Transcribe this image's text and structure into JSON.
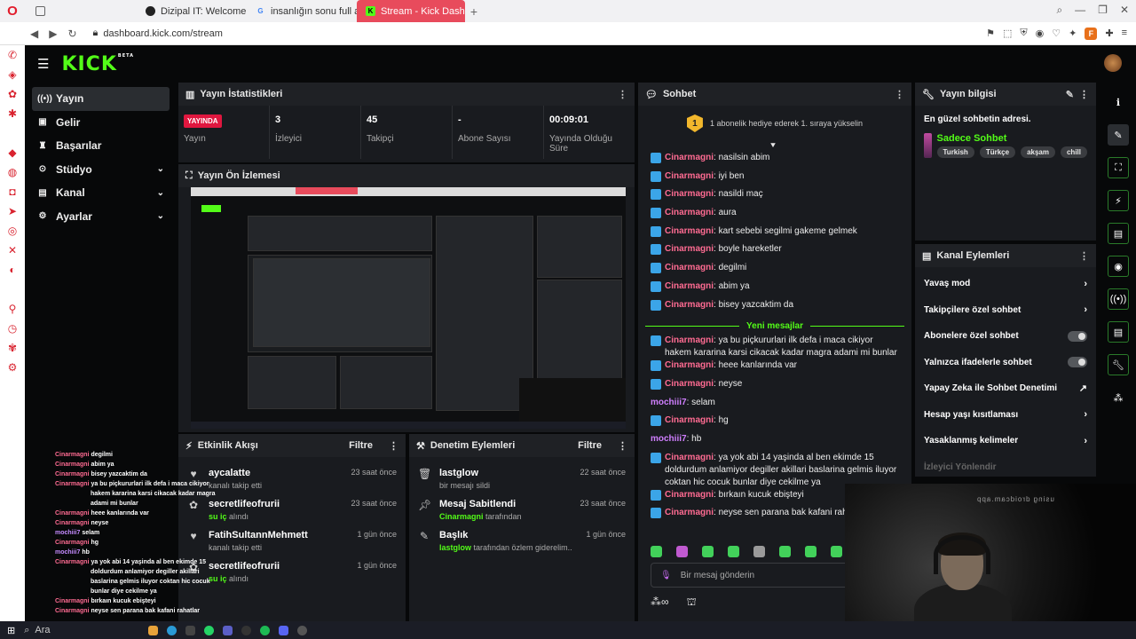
{
  "browser": {
    "tabs": [
      {
        "label": "Dizipal IT: Welcome to Di",
        "active": false
      },
      {
        "label": "insanlığın sonu full altyaz",
        "active": false
      },
      {
        "label": "Stream - Kick Dashboard",
        "active": true
      }
    ],
    "url": "dashboard.kick.com/stream",
    "profile_letter": "F"
  },
  "app": {
    "logo": "KICK",
    "beta": "BETA",
    "nav": [
      {
        "label": "Yayın",
        "active": true,
        "chevron": false
      },
      {
        "label": "Gelir",
        "active": false,
        "chevron": false
      },
      {
        "label": "Başarılar",
        "active": false,
        "chevron": false
      },
      {
        "label": "Stüdyo",
        "active": false,
        "chevron": true
      },
      {
        "label": "Kanal",
        "active": false,
        "chevron": true
      },
      {
        "label": "Ayarlar",
        "active": false,
        "chevron": true
      }
    ]
  },
  "stats": {
    "title": "Yayın İstatistikleri",
    "items": [
      {
        "value": "YAYINDA",
        "label": "Yayın",
        "badge": true
      },
      {
        "value": "3",
        "label": "İzleyici"
      },
      {
        "value": "45",
        "label": "Takipçi"
      },
      {
        "value": "-",
        "label": "Abone Sayısı"
      },
      {
        "value": "00:09:01",
        "label": "Yayında Olduğu Süre"
      }
    ]
  },
  "preview": {
    "title": "Yayın Ön İzlemesi"
  },
  "feed": {
    "title": "Etkinlik Akışı",
    "filter": "Filtre",
    "rows": [
      {
        "icon": "heart",
        "name": "aycalatte",
        "sub": "kanalı takip etti",
        "time": "23 saat önce"
      },
      {
        "icon": "kick",
        "name": "secretlifeofrurii",
        "sub_green": "su iç",
        "sub": " alındı",
        "time": "23 saat önce"
      },
      {
        "icon": "heart",
        "name": "FatihSultannMehmett",
        "sub": "kanalı takip etti",
        "time": "1 gün önce"
      },
      {
        "icon": "kick",
        "name": "secretlifeofrurii",
        "sub_green": "su iç",
        "sub": " alındı",
        "time": "1 gün önce"
      }
    ]
  },
  "moderation": {
    "title": "Denetim Eylemleri",
    "filter": "Filtre",
    "rows": [
      {
        "icon": "trash",
        "name": "lastglow",
        "sub": "bir mesajı sildi",
        "time": "22 saat önce"
      },
      {
        "icon": "pin",
        "name": "Mesaj Sabitlendi",
        "sub_green": "Cinarmagni",
        "sub": " tarafından",
        "time": "23 saat önce"
      },
      {
        "icon": "edit",
        "name": "Başlık",
        "sub_green": "lastglow",
        "sub": " tarafından özlem giderelim... olarak değiştirildi",
        "time": "1 gün önce"
      }
    ]
  },
  "chat": {
    "title": "Sohbet",
    "notice": "1 abonelik hediye ederek 1. sıraya yükselin",
    "notice_rank": "1",
    "new_messages": "Yeni mesajlar",
    "messages_before": [
      {
        "user": "Cinarmagni",
        "text": "nasilsin abim"
      },
      {
        "user": "Cinarmagni",
        "text": "iyi ben"
      },
      {
        "user": "Cinarmagni",
        "text": "nasildi maç"
      },
      {
        "user": "Cinarmagni",
        "text": "aura"
      },
      {
        "user": "Cinarmagni",
        "text": "kart sebebi segilmi gakeme gelmek"
      },
      {
        "user": "Cinarmagni",
        "text": "boyle hareketler"
      },
      {
        "user": "Cinarmagni",
        "text": "degilmi"
      },
      {
        "user": "Cinarmagni",
        "text": "abim ya"
      },
      {
        "user": "Cinarmagni",
        "text": "bisey yazcaktim da"
      }
    ],
    "messages_after": [
      {
        "user": "Cinarmagni",
        "text": "ya bu piçkururlari ilk defa i maca cikiyor hakem kararina karsi cikacak kadar magra adami mi bunlar",
        "badge": true
      },
      {
        "user": "Cinarmagni",
        "text": "heee kanlarında var",
        "badge": true
      },
      {
        "user": "Cinarmagni",
        "text": "neyse",
        "badge": true
      },
      {
        "user": "mochiii7",
        "text": "selam",
        "badge": false
      },
      {
        "user": "Cinarmagni",
        "text": "hg",
        "badge": true
      },
      {
        "user": "mochiii7",
        "text": "hb",
        "badge": false
      },
      {
        "user": "Cinarmagni",
        "text": "ya yok abi 14 yaşinda al ben ekimde 15 doldurdum anlamiyor degiller akillari baslarina gelmis iluyor coktan hic cocuk bunlar diye cekilme ya",
        "badge": true
      },
      {
        "user": "Cinarmagni",
        "text": "bırkaın kucuk ebişteyi",
        "badge": true
      },
      {
        "user": "Cinarmagni",
        "text": "neyse sen parana bak kafani rahatlar",
        "badge": true
      }
    ],
    "input_placeholder": "Bir mesaj gönderin"
  },
  "info": {
    "title": "Yayın bilgisi",
    "stream_title": "En güzel sohbetin adresi.",
    "category": "Sadece Sohbet",
    "tags": [
      "Turkish",
      "Türkçe",
      "akşam",
      "chill"
    ]
  },
  "actions": {
    "title": "Kanal Eylemleri",
    "items": [
      {
        "label": "Yavaş mod",
        "control": "arrow"
      },
      {
        "label": "Takipçilere özel sohbet",
        "control": "arrow"
      },
      {
        "label": "Abonelere özel sohbet",
        "control": "toggle"
      },
      {
        "label": "Yalnızca ifadelerle sohbet",
        "control": "toggle"
      },
      {
        "label": "Yapay Zeka ile Sohbet Denetimi",
        "control": "external"
      },
      {
        "label": "Hesap yaşı kısıtlaması",
        "control": "arrow"
      },
      {
        "label": "Yasaklanmış kelimeler",
        "control": "arrow"
      },
      {
        "label": "İzleyici Yönlendir",
        "control": "none"
      }
    ]
  },
  "overlay_chat": [
    {
      "user": "Cinarmagni",
      "text": "degilmi"
    },
    {
      "user": "Cinarmagni",
      "text": "abim ya"
    },
    {
      "user": "Cinarmagni",
      "text": "bisey yazcaktim da"
    },
    {
      "user": "Cinarmagni",
      "text": "ya bu piçkururlari ilk defa i maca cikiyor hakem kararina karsi cikacak kadar magra adami mi bunlar"
    },
    {
      "user": "Cinarmagni",
      "text": "heee kanlarında var"
    },
    {
      "user": "Cinarmagni",
      "text": "neyse"
    },
    {
      "user": "mochiii7",
      "text": "selam"
    },
    {
      "user": "Cinarmagni",
      "text": "hg"
    },
    {
      "user": "mochiii7",
      "text": "hb"
    },
    {
      "user": "Cinarmagni",
      "text": "ya yok abi 14 yaşinda al ben ekimde 15 doldurdum anlamiyor degiller akillari baslarina gelmis iluyor coktan hic cocuk bunlar diye cekilme ya"
    },
    {
      "user": "Cinarmagni",
      "text": "bırkaın kucuk ebişteyi"
    },
    {
      "user": "Cinarmagni",
      "text": "neyse sen parana bak kafani rahatlar"
    }
  ],
  "webcam": {
    "watermark": "using droidcam.app"
  },
  "taskbar": {
    "search": "Ara"
  },
  "colors": {
    "accent": "#53fc18",
    "live": "#e0173f",
    "chat_user": "#ff6b92",
    "chat_user2": "#d07fff"
  }
}
